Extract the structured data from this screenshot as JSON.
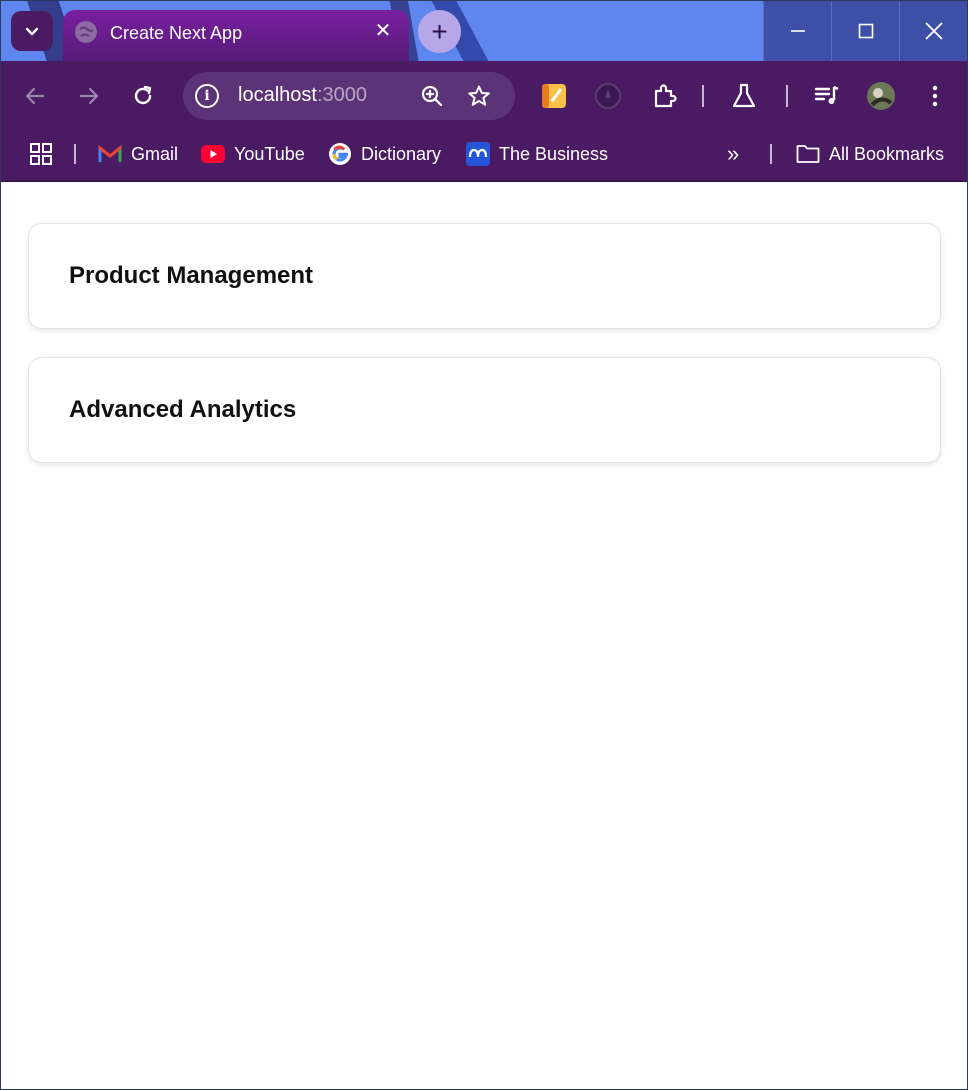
{
  "browser": {
    "tab": {
      "title": "Create Next App",
      "close_label": "✕"
    },
    "new_tab_label": "+",
    "window_controls": {
      "minimize": "—",
      "maximize": "☐",
      "close": "✕"
    },
    "address": {
      "host": "localhost",
      "port": ":3000"
    },
    "bookmarks": [
      {
        "label": "Gmail",
        "icon": "gmail-icon"
      },
      {
        "label": "YouTube",
        "icon": "youtube-icon"
      },
      {
        "label": "Dictionary",
        "icon": "google-icon"
      },
      {
        "label": "The Business",
        "icon": "abc-icon"
      }
    ],
    "overflow_label": "»",
    "all_bookmarks_label": "All Bookmarks"
  },
  "page": {
    "cards": [
      {
        "title": "Product Management"
      },
      {
        "title": "Advanced Analytics"
      }
    ]
  },
  "colors": {
    "titlebar": "#5f86ee",
    "toolbar": "#4a1a62",
    "tab_active": "#7a1fa0"
  }
}
